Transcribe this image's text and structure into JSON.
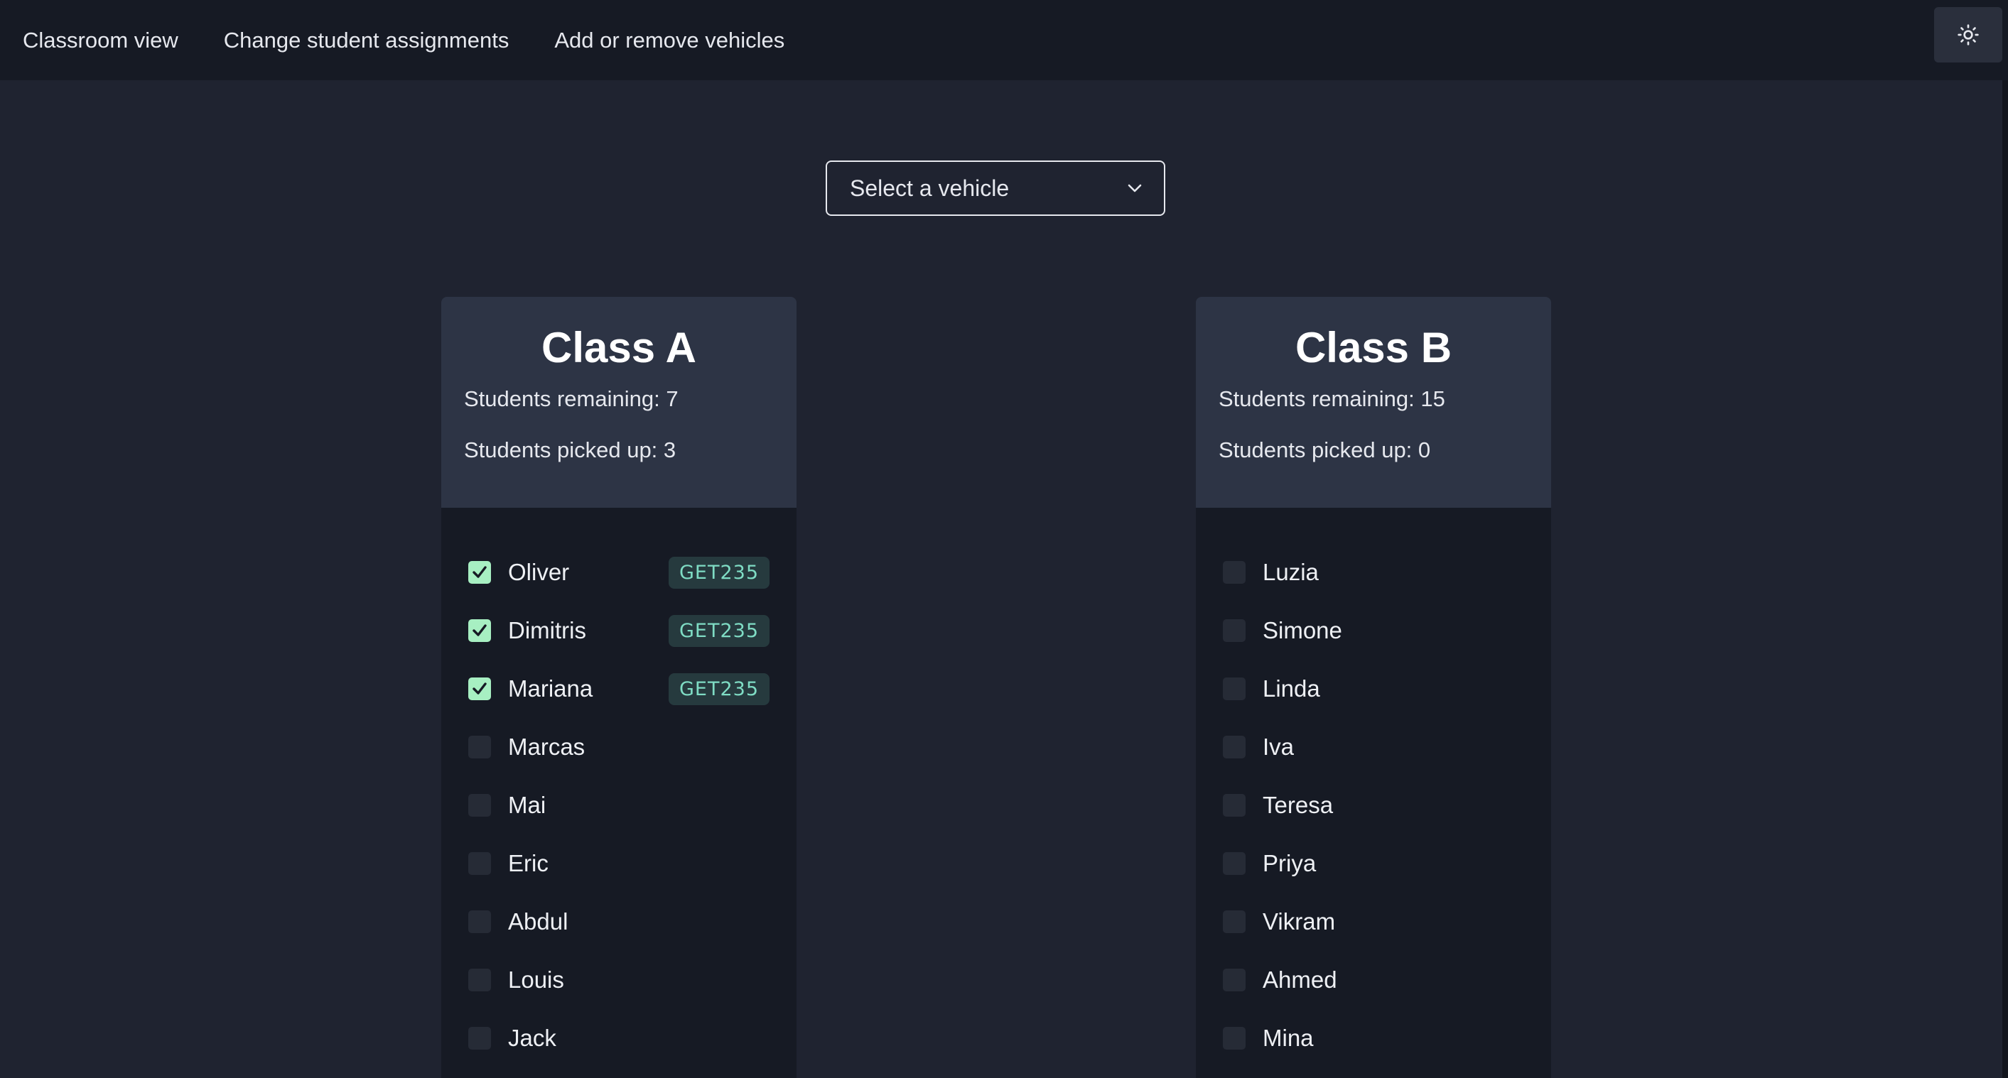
{
  "nav": {
    "links": [
      "Classroom view",
      "Change student assignments",
      "Add or remove vehicles"
    ],
    "theme_toggle_icon": "sun-icon"
  },
  "vehicle_select": {
    "label": "Select a vehicle",
    "icon": "chevron-down-icon"
  },
  "classes": [
    {
      "title": "Class A",
      "remaining": "Students remaining: 7",
      "picked_up": "Students picked up: 3",
      "students": [
        {
          "name": "Oliver",
          "checked": true,
          "vehicle": "GET235"
        },
        {
          "name": "Dimitris",
          "checked": true,
          "vehicle": "GET235"
        },
        {
          "name": "Mariana",
          "checked": true,
          "vehicle": "GET235"
        },
        {
          "name": "Marcas",
          "checked": false,
          "vehicle": ""
        },
        {
          "name": "Mai",
          "checked": false,
          "vehicle": ""
        },
        {
          "name": "Eric",
          "checked": false,
          "vehicle": ""
        },
        {
          "name": "Abdul",
          "checked": false,
          "vehicle": ""
        },
        {
          "name": "Louis",
          "checked": false,
          "vehicle": ""
        },
        {
          "name": "Jack",
          "checked": false,
          "vehicle": ""
        }
      ]
    },
    {
      "title": "Class B",
      "remaining": "Students remaining: 15",
      "picked_up": "Students picked up: 0",
      "students": [
        {
          "name": "Luzia",
          "checked": false,
          "vehicle": ""
        },
        {
          "name": "Simone",
          "checked": false,
          "vehicle": ""
        },
        {
          "name": "Linda",
          "checked": false,
          "vehicle": ""
        },
        {
          "name": "Iva",
          "checked": false,
          "vehicle": ""
        },
        {
          "name": "Teresa",
          "checked": false,
          "vehicle": ""
        },
        {
          "name": "Priya",
          "checked": false,
          "vehicle": ""
        },
        {
          "name": "Vikram",
          "checked": false,
          "vehicle": ""
        },
        {
          "name": "Ahmed",
          "checked": false,
          "vehicle": ""
        },
        {
          "name": "Mina",
          "checked": false,
          "vehicle": ""
        }
      ]
    }
  ],
  "colors": {
    "page_bg": "#1f2330",
    "nav_bg": "#161a24",
    "card_header_bg": "#2d3445",
    "checkbox_checked": "#a7efc2",
    "badge_text": "#7fdcc4"
  }
}
